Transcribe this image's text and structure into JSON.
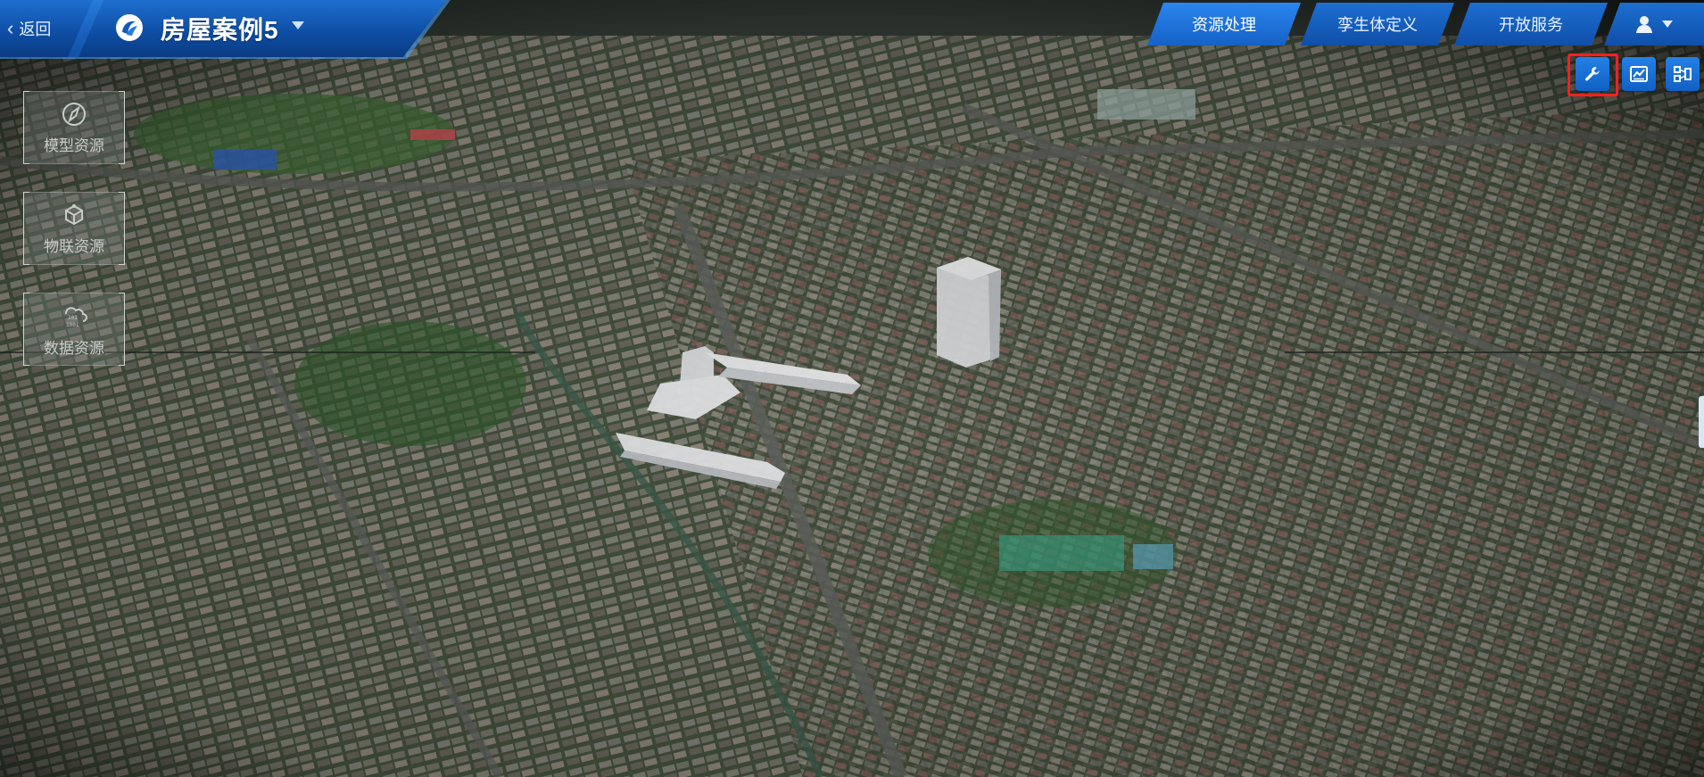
{
  "header": {
    "back_label": "返回",
    "project_title": "房屋案例5",
    "tabs": [
      {
        "label": "资源处理",
        "active": true
      },
      {
        "label": "孪生体定义",
        "active": false
      },
      {
        "label": "开放服务",
        "active": false
      }
    ],
    "user_icon": "user-icon"
  },
  "toolbar": {
    "buttons": [
      {
        "name": "wrench-icon",
        "highlighted": true
      },
      {
        "name": "chart-panel-icon",
        "highlighted": false
      },
      {
        "name": "hierarchy-icon",
        "highlighted": false
      }
    ],
    "highlight_color": "#ff2020"
  },
  "sidebar": {
    "items": [
      {
        "label": "模型资源",
        "icon": "compass-icon"
      },
      {
        "label": "物联资源",
        "icon": "iot-cube-icon"
      },
      {
        "label": "数据资源",
        "icon": "cloud-data-icon"
      }
    ]
  },
  "colors": {
    "header_blue": "#1561c6",
    "accent_blue": "#2a86ee"
  }
}
